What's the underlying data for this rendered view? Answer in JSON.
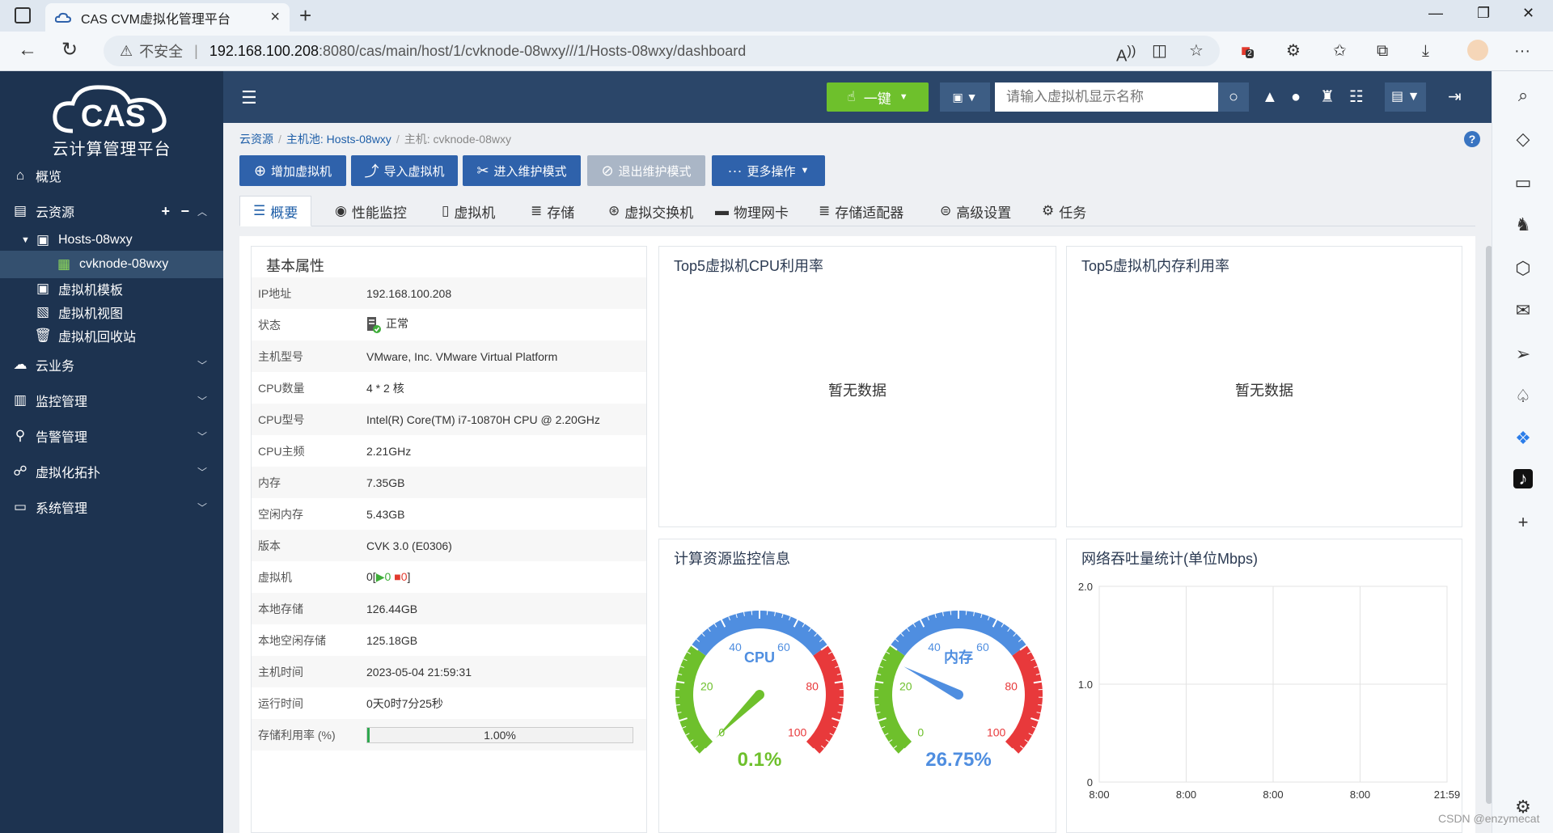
{
  "browser": {
    "tab_title": "CAS CVM虚拟化管理平台",
    "insecure_label": "不安全",
    "url_host": "192.168.100.208",
    "url_path": ":8080/cas/main/host/1/cvknode-08wxy///1/Hosts-08wxy/dashboard",
    "badge_count": "2"
  },
  "sidebar": {
    "logo_text": "CAS",
    "logo_subtitle": "云计算管理平台",
    "items": [
      {
        "label": "概览",
        "icon": "home-icon"
      },
      {
        "label": "云资源",
        "icon": "cloud-resource-icon",
        "actions": [
          "+",
          "−"
        ]
      },
      {
        "label": "Hosts-08wxy",
        "icon": "host-pool-icon"
      },
      {
        "label": "cvknode-08wxy",
        "icon": "host-node-icon"
      },
      {
        "label": "虚拟机模板",
        "icon": "template-icon"
      },
      {
        "label": "虚拟机视图",
        "icon": "vm-view-icon"
      },
      {
        "label": "虚拟机回收站",
        "icon": "trash-icon"
      },
      {
        "label": "云业务",
        "icon": "cloud-icon"
      },
      {
        "label": "监控管理",
        "icon": "monitor-icon"
      },
      {
        "label": "告警管理",
        "icon": "alarm-icon"
      },
      {
        "label": "虚拟化拓扑",
        "icon": "topology-icon"
      },
      {
        "label": "系统管理",
        "icon": "system-icon"
      }
    ]
  },
  "header": {
    "one_key_label": "一键",
    "search_placeholder": "请输入虚拟机显示名称"
  },
  "breadcrumb": {
    "root": "云资源",
    "pool": "主机池: Hosts-08wxy",
    "host": "主机: cvknode-08wxy"
  },
  "actions": {
    "add_vm": "增加虚拟机",
    "import_vm": "导入虚拟机",
    "enter_maintenance": "进入维护模式",
    "exit_maintenance": "退出维护模式",
    "more": "更多操作"
  },
  "tabs": [
    "概要",
    "性能监控",
    "虚拟机",
    "存储",
    "虚拟交换机",
    "物理网卡",
    "存储适配器",
    "高级设置",
    "任务"
  ],
  "props": {
    "title": "基本属性",
    "rows": [
      {
        "k": "IP地址",
        "v": "192.168.100.208"
      },
      {
        "k": "状态",
        "v": "正常"
      },
      {
        "k": "主机型号",
        "v": "VMware, Inc. VMware Virtual Platform"
      },
      {
        "k": "CPU数量",
        "v": "4 * 2 核"
      },
      {
        "k": "CPU型号",
        "v": "Intel(R) Core(TM) i7-10870H CPU @ 2.20GHz"
      },
      {
        "k": "CPU主频",
        "v": "2.21GHz"
      },
      {
        "k": "内存",
        "v": "7.35GB"
      },
      {
        "k": "空闲内存",
        "v": "5.43GB"
      },
      {
        "k": "版本",
        "v": "CVK 3.0 (E0306)"
      },
      {
        "k": "虚拟机",
        "v": ""
      },
      {
        "k": "本地存储",
        "v": "126.44GB"
      },
      {
        "k": "本地空闲存储",
        "v": "125.18GB"
      },
      {
        "k": "主机时间",
        "v": "2023-05-04 21:59:31"
      },
      {
        "k": "运行时间",
        "v": "0天0时7分25秒"
      },
      {
        "k": "存储利用率 (%)",
        "v": "1.00%"
      }
    ],
    "vm_counts": {
      "total": "0",
      "running": "0",
      "stopped": "0"
    },
    "storage_util": 0.01
  },
  "panels": {
    "cpu_top5": {
      "title": "Top5虚拟机CPU利用率",
      "empty": "暂无数据"
    },
    "mem_top5": {
      "title": "Top5虚拟机内存利用率",
      "empty": "暂无数据"
    },
    "compute": {
      "title": "计算资源监控信息"
    },
    "network": {
      "title": "网络吞吐量统计(单位Mbps)"
    }
  },
  "gauges": [
    {
      "label": "CPU",
      "value": 0.1,
      "display": "0.1%",
      "ticks": [
        "0",
        "20",
        "40",
        "60",
        "80",
        "100"
      ]
    },
    {
      "label": "内存",
      "value": 26.75,
      "display": "26.75%",
      "ticks": [
        "0",
        "20",
        "40",
        "60",
        "80",
        "100"
      ]
    }
  ],
  "chart_data": {
    "type": "line",
    "title": "网络吞吐量统计(单位Mbps)",
    "x_ticks": [
      "8:00",
      "8:00",
      "8:00",
      "8:00",
      "21:59"
    ],
    "y_ticks": [
      "0",
      "1.0",
      "2.0"
    ],
    "ylim": [
      0,
      2.0
    ],
    "series": [],
    "grid": true
  },
  "watermark": "CSDN @enzymecat",
  "colors": {
    "accent": "#2f62ab",
    "green": "#6ec02c",
    "sidebar": "#1d3350",
    "header": "#2b4669"
  }
}
